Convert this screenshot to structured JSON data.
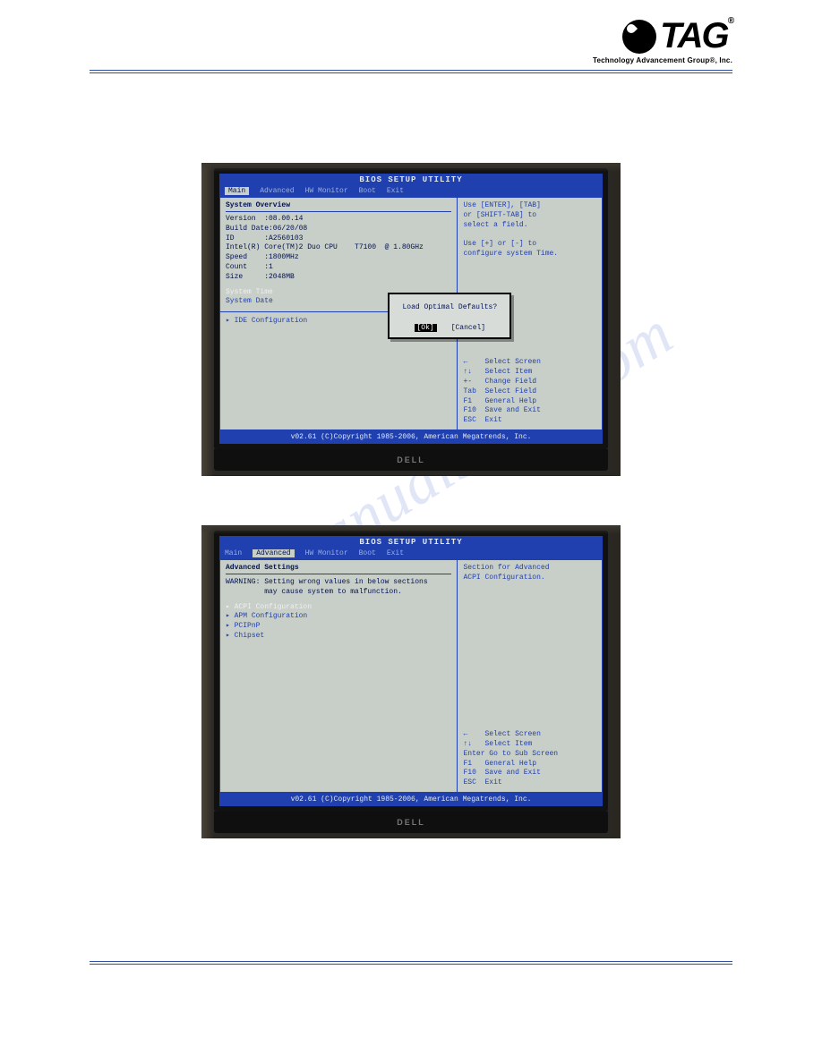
{
  "logo": {
    "text": "TAG",
    "subtitle": "Technology Advancement Group®, Inc."
  },
  "watermark": "manualshive.com",
  "monitor_brand": "DELL",
  "bios1": {
    "title": "BIOS SETUP UTILITY",
    "tabs": [
      "Main",
      "Advanced",
      "HW Monitor",
      "Boot",
      "Exit"
    ],
    "active_tab": "Main",
    "heading": "System Overview",
    "lines": {
      "version": "Version  :08.00.14",
      "build": "Build Date:06/20/08",
      "id": "ID       :A2560103",
      "cpu": "Intel(R) Core(TM)2 Duo CPU    T7100  @ 1.80GHz",
      "speed": "Speed    :1800MHz",
      "count": "Count    :1",
      "size": "Size     :2048MB"
    },
    "sys_time": "System Time",
    "sys_date": "System Date",
    "ide": "▸ IDE Configuration",
    "help_top": "Use [ENTER], [TAB]\nor [SHIFT-TAB] to\nselect a field.\n\nUse [+] or [-] to\nconfigure system Time.",
    "help_bottom": "←    Select Screen\n↑↓   Select Item\n+-   Change Field\nTab  Select Field\nF1   General Help\nF10  Save and Exit\nESC  Exit",
    "dialog": {
      "question": "Load Optimal Defaults?",
      "ok": "[Ok]",
      "cancel": "[Cancel]"
    },
    "footer": "v02.61 (C)Copyright 1985-2006, American Megatrends, Inc."
  },
  "bios2": {
    "title": "BIOS SETUP UTILITY",
    "tabs": [
      "Main",
      "Advanced",
      "HW Monitor",
      "Boot",
      "Exit"
    ],
    "active_tab": "Advanced",
    "heading": "Advanced Settings",
    "warning": "WARNING: Setting wrong values in below sections\n         may cause system to malfunction.",
    "items": {
      "acpi": "▸ ACPI Configuration",
      "apm": "▸ APM Configuration",
      "pcipnp": "▸ PCIPnP",
      "chipset": "▸ Chipset"
    },
    "help_top": "Section for Advanced\nACPI Configuration.",
    "help_bottom": "←    Select Screen\n↑↓   Select Item\nEnter Go to Sub Screen\nF1   General Help\nF10  Save and Exit\nESC  Exit",
    "footer": "v02.61 (C)Copyright 1985-2006, American Megatrends, Inc."
  }
}
